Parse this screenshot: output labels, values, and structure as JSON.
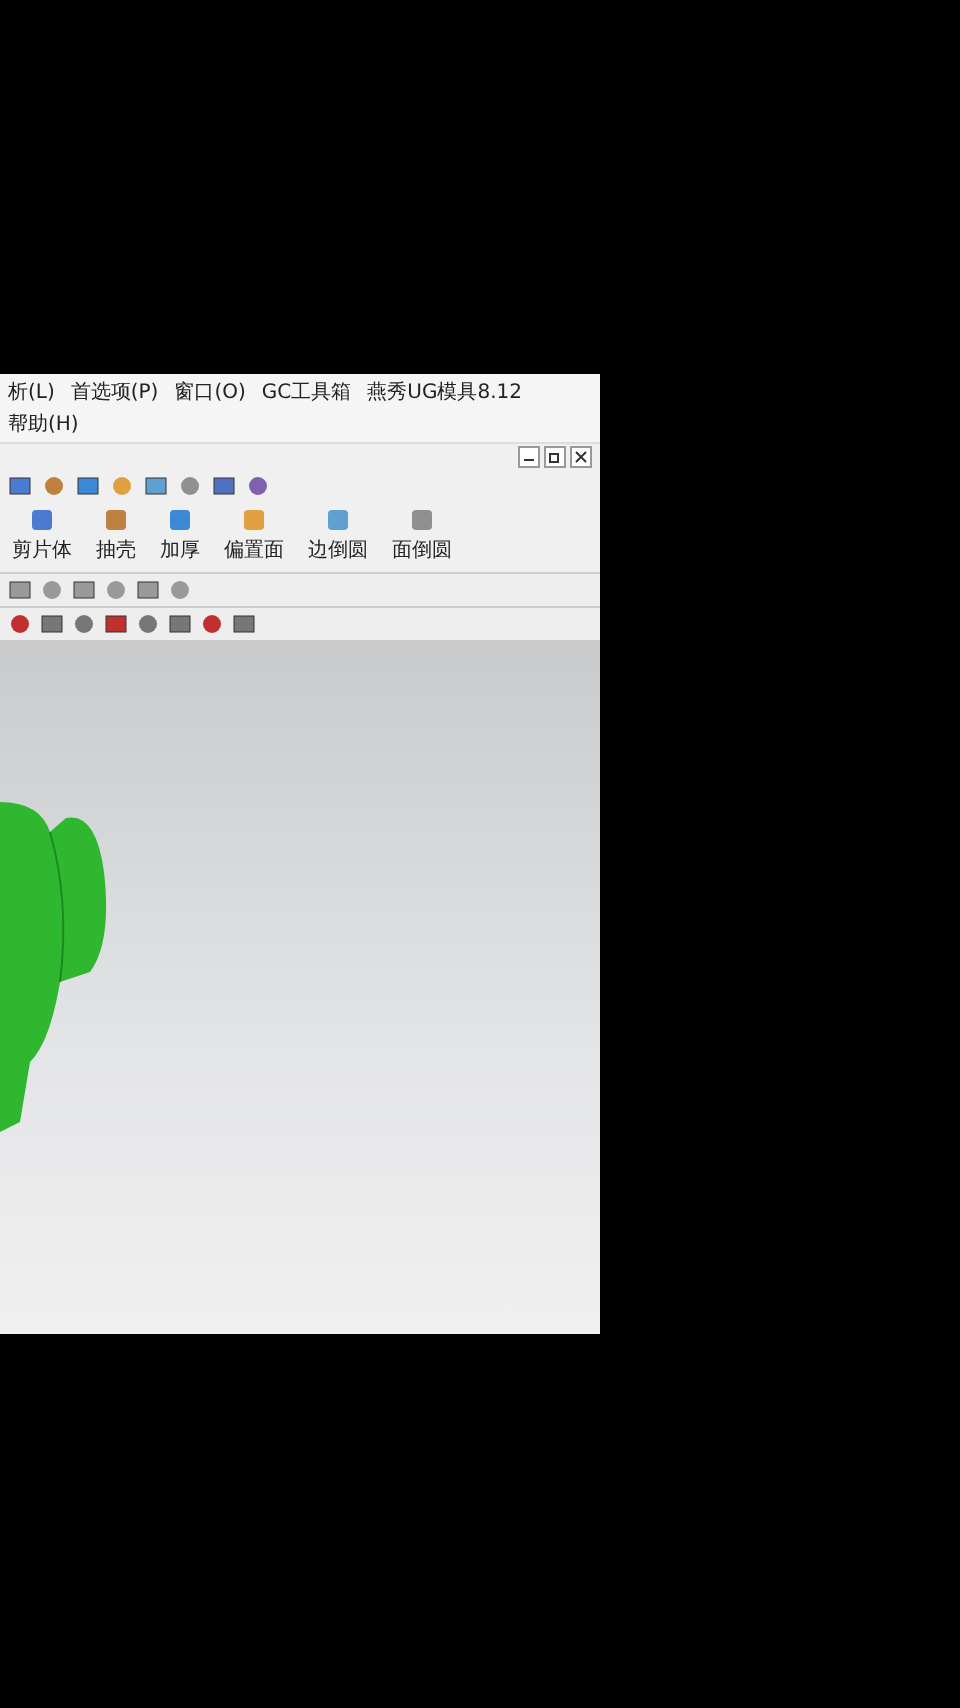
{
  "menu_bar": {
    "items": [
      "析(L)",
      "首选项(P)",
      "窗口(O)",
      "GC工具箱",
      "燕秀UG模具8.12",
      "帮助(H)"
    ]
  },
  "ribbon": {
    "buttons": [
      "剪片体",
      "抽壳",
      "加厚",
      "偏置面",
      "边倒圆",
      "面倒圆"
    ]
  }
}
